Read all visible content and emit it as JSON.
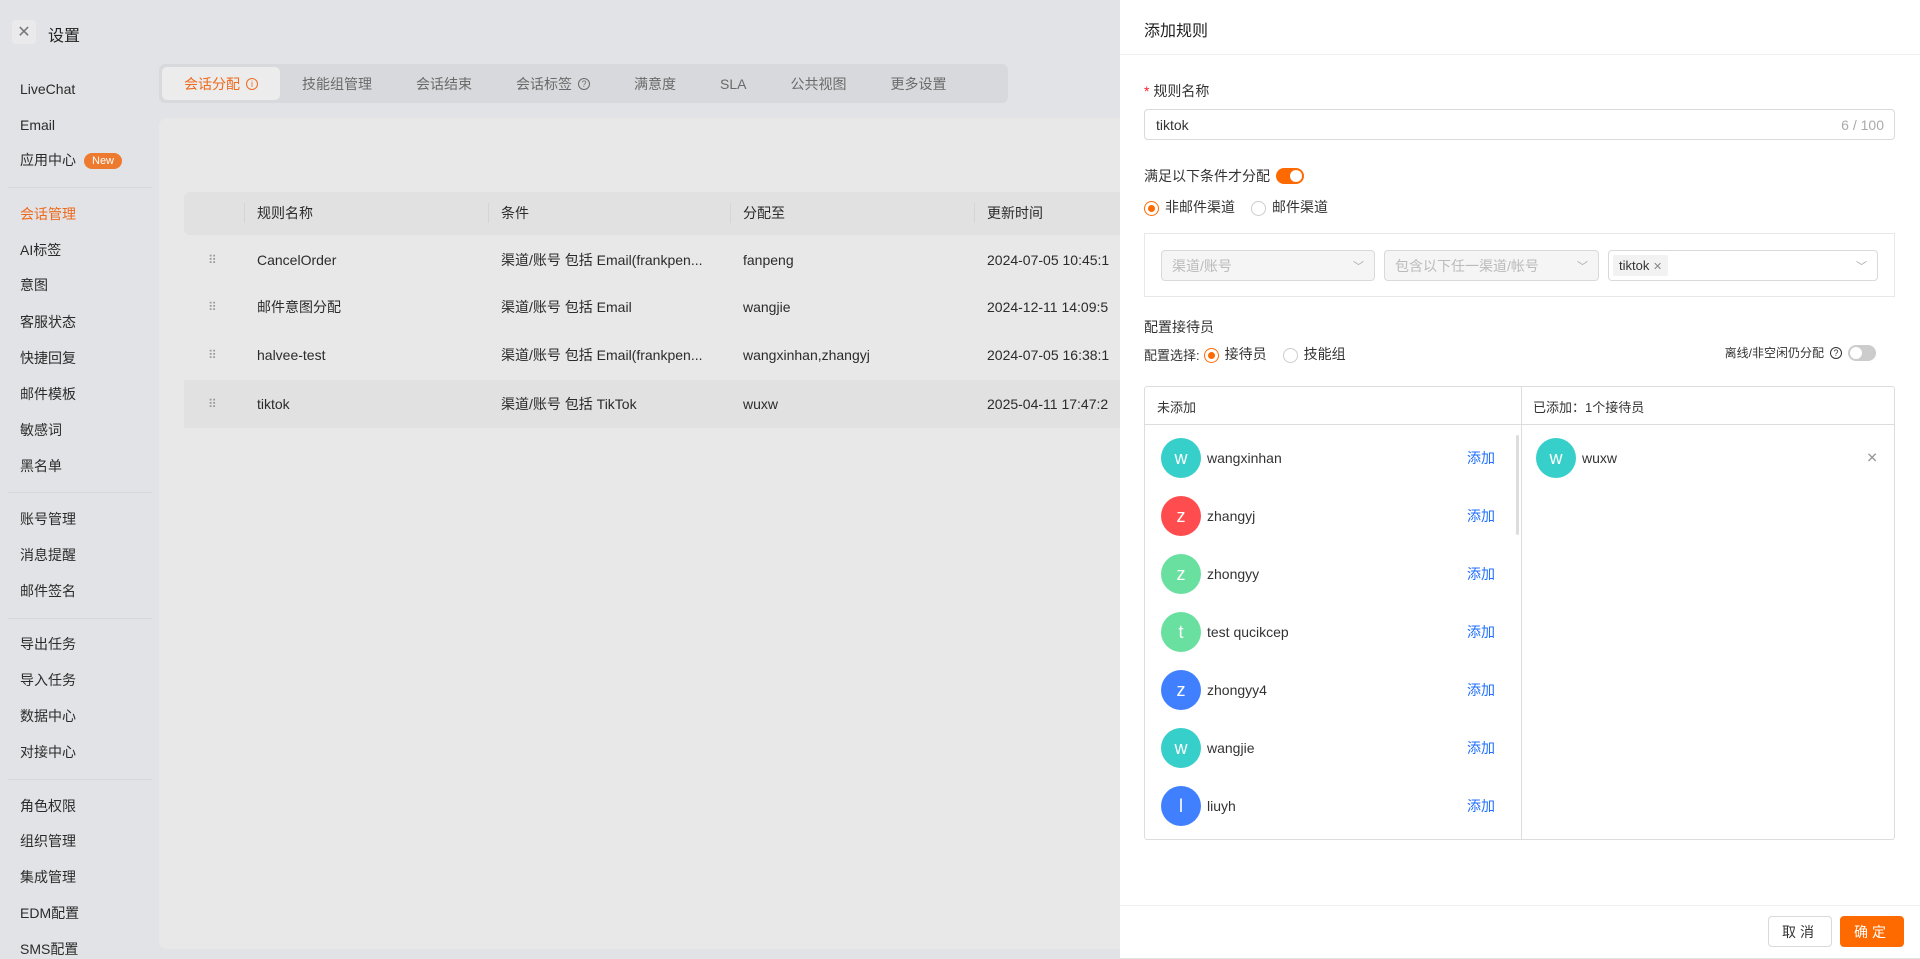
{
  "header": {
    "title": "设置"
  },
  "sidebar": {
    "items": [
      "LiveChat",
      "Email",
      "应用中心",
      "会话管理",
      "AI标签",
      "意图",
      "客服状态",
      "快捷回复",
      "邮件模板",
      "敏感词",
      "黑名单",
      "账号管理",
      "消息提醒",
      "邮件签名",
      "导出任务",
      "导入任务",
      "数据中心",
      "对接中心",
      "角色权限",
      "组织管理",
      "集成管理",
      "EDM配置",
      "SMS配置"
    ],
    "new_badge": "New",
    "active": "会话管理"
  },
  "tabs": [
    "会话分配",
    "技能组管理",
    "会话结束",
    "会话标签",
    "满意度",
    "SLA",
    "公共视图",
    "更多设置"
  ],
  "table": {
    "headers": [
      "规则名称",
      "条件",
      "分配至",
      "更新时间"
    ],
    "rows": [
      [
        "CancelOrder",
        "渠道/账号 包括 Email(frankpen...",
        "fanpeng",
        "2024-07-05 10:45:1"
      ],
      [
        "邮件意图分配",
        "渠道/账号 包括 Email",
        "wangjie",
        "2024-12-11 14:09:5"
      ],
      [
        "halvee-test",
        "渠道/账号 包括 Email(frankpen...",
        "wangxinhan,zhangyj",
        "2024-07-05 16:38:1"
      ],
      [
        "tiktok",
        "渠道/账号 包括 TikTok",
        "wuxw",
        "2025-04-11 17:47:2"
      ]
    ]
  },
  "panel": {
    "title": "添加规则",
    "name_label": "规则名称",
    "required_mark": "*",
    "name_value": "tiktok",
    "name_count": "6 / 100",
    "condition_label": "满足以下条件才分配",
    "condition_enabled": true,
    "channel_options": [
      "非邮件渠道",
      "邮件渠道"
    ],
    "select1": "渠道/账号",
    "select2": "包含以下任一渠道/帐号",
    "tag": "tiktok",
    "agents_label": "配置接待员",
    "config_select_label": "配置选择:",
    "config_options": [
      "接待员",
      "技能组"
    ],
    "offline_label": "离线/非空闲仍分配",
    "offline_enabled": false,
    "unadded_header": "未添加",
    "added_header": "已添加：1个接待员",
    "add_label": "添加",
    "unadded": [
      {
        "initial": "w",
        "name": "wangxinhan",
        "color": "#36cfc9"
      },
      {
        "initial": "z",
        "name": "zhangyj",
        "color": "#ff4d4f"
      },
      {
        "initial": "z",
        "name": "zhongyy",
        "color": "#69e09f"
      },
      {
        "initial": "t",
        "name": "test qucikcep",
        "color": "#69e09f"
      },
      {
        "initial": "z",
        "name": "zhongyy4",
        "color": "#4080ff"
      },
      {
        "initial": "w",
        "name": "wangjie",
        "color": "#36cfc9"
      },
      {
        "initial": "l",
        "name": "liuyh",
        "color": "#4080ff"
      }
    ],
    "added": [
      {
        "initial": "w",
        "name": "wuxw",
        "color": "#36cfc9"
      }
    ],
    "cancel": "取消",
    "ok": "确定"
  },
  "colors": {
    "accent": "#ff6a00",
    "link": "#1f6fff"
  }
}
